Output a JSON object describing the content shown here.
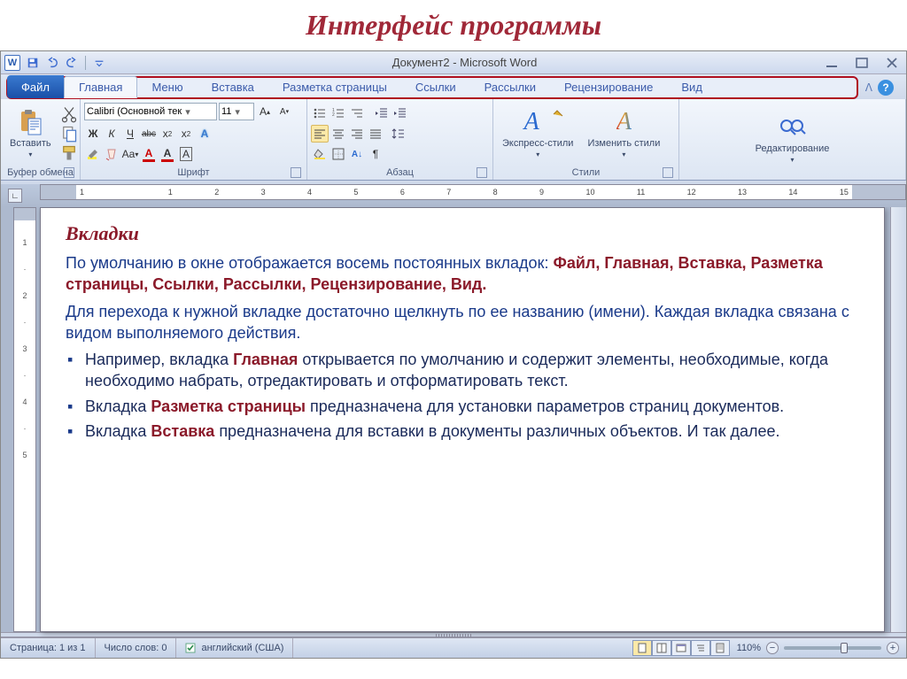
{
  "page_heading": "Интерфейс программы",
  "titlebar": {
    "title": "Документ2 - Microsoft Word"
  },
  "tabs": {
    "file": "Файл",
    "items": [
      "Главная",
      "Меню",
      "Вставка",
      "Разметка страницы",
      "Ссылки",
      "Рассылки",
      "Рецензирование",
      "Вид"
    ],
    "active_index": 0
  },
  "ribbon": {
    "clipboard": {
      "paste": "Вставить",
      "label": "Буфер обмена"
    },
    "font": {
      "name": "Calibri (Основной тек",
      "size": "11",
      "bold": "Ж",
      "italic": "К",
      "underline": "Ч",
      "strike": "abc",
      "label": "Шрифт"
    },
    "paragraph": {
      "label": "Абзац"
    },
    "styles": {
      "quick": "Экспресс-стили",
      "change": "Изменить стили",
      "label": "Стили"
    },
    "editing": {
      "label": "Редактирование"
    }
  },
  "ruler": {
    "marks": [
      "1",
      "",
      "1",
      "2",
      "3",
      "4",
      "5",
      "6",
      "7",
      "8",
      "9",
      "10",
      "11",
      "12",
      "13",
      "14",
      "15"
    ]
  },
  "document": {
    "heading": "Вкладки",
    "intro": "По умолчанию в окне отображается восемь постоянных вкладок:",
    "tabs_list": "Файл,   Главная,   Вставка,   Разметка страницы,   Ссылки,   Рассылки, Рецензирование,   Вид.",
    "after": "Для перехода к нужной вкладке достаточно щелкнуть по ее названию (имени). Каждая вкладка связана с видом выполняемого действия.",
    "b1a": "Например, вкладка ",
    "b1b": "Главная",
    "b1c": " открывается по умолчанию  и содержит элементы, необходимые, когда необходимо набрать, отредактировать и отформатировать текст.",
    "b2a": "Вкладка ",
    "b2b": "Разметка страницы",
    "b2c": " предназначена для установки параметров страниц документов.",
    "b3a": " Вкладка ",
    "b3b": "Вставка",
    "b3c": " предназначена для вставки в документы различных объектов. И так далее."
  },
  "statusbar": {
    "page": "Страница: 1 из 1",
    "words": "Число слов: 0",
    "lang": "английский (США)",
    "zoom": "110%"
  }
}
